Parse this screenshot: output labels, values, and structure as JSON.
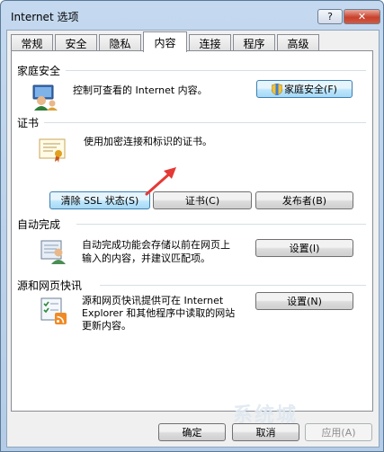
{
  "window": {
    "title": "Internet 选项",
    "help_label": "?",
    "close_label": "✕"
  },
  "tabs": [
    {
      "label": "常规"
    },
    {
      "label": "安全"
    },
    {
      "label": "隐私"
    },
    {
      "label": "内容",
      "active": true
    },
    {
      "label": "连接"
    },
    {
      "label": "程序"
    },
    {
      "label": "高级"
    }
  ],
  "family": {
    "heading": "家庭安全",
    "description": "控制可查看的 Internet 内容。",
    "button": "家庭安全(F)",
    "icon": "family-safety-icon"
  },
  "certificates": {
    "heading": "证书",
    "description": "使用加密连接和标识的证书。",
    "clear_ssl": "清除 SSL 状态(S)",
    "certs": "证书(C)",
    "publishers": "发布者(B)",
    "icon": "certificate-icon"
  },
  "autocomplete": {
    "heading": "自动完成",
    "line1": "自动完成功能会存储以前在网页上",
    "line2": "输入的内容，并建议匹配项。",
    "button": "设置(I)",
    "icon": "autocomplete-icon"
  },
  "feeds": {
    "heading": "源和网页快讯",
    "line1": "源和网页快讯提供可在 Internet",
    "line2": "Explorer 和其他程序中读取的网站",
    "line3": "更新内容。",
    "button": "设置(N)",
    "icon": "feeds-icon"
  },
  "footer": {
    "ok": "确定",
    "cancel": "取消",
    "apply": "应用(A)"
  },
  "watermark": "系统城",
  "colors": {
    "arrow": "#e53935",
    "close": "#c8412c",
    "title_bar": "#c4d9ef"
  }
}
